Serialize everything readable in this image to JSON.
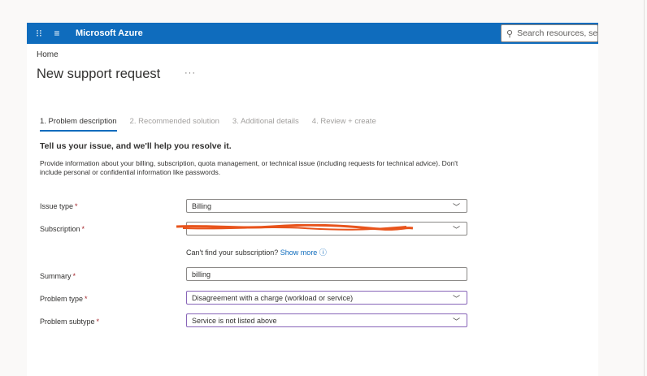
{
  "header": {
    "app_name": "Microsoft Azure",
    "search_placeholder": "Search resources, ser"
  },
  "breadcrumb": "Home",
  "page": {
    "title": "New support request",
    "more": "···"
  },
  "tabs": [
    {
      "label": "1. Problem description",
      "active": true
    },
    {
      "label": "2. Recommended solution",
      "active": false
    },
    {
      "label": "3. Additional details",
      "active": false
    },
    {
      "label": "4. Review + create",
      "active": false
    }
  ],
  "form": {
    "heading": "Tell us your issue, and we'll help you resolve it.",
    "description": "Provide information about your billing, subscription, quota management, or technical issue (including requests for technical advice). Don't include personal or confidential information like passwords.",
    "issue_type": {
      "label": "Issue type",
      "value": "Billing"
    },
    "subscription": {
      "label": "Subscription",
      "value": ""
    },
    "subscription_hint": "Can't find your subscription?",
    "show_more": "Show more",
    "summary": {
      "label": "Summary",
      "value": "billing"
    },
    "problem_type": {
      "label": "Problem type",
      "value": "Disagreement with a charge (workload or service)"
    },
    "problem_subtype": {
      "label": "Problem subtype",
      "value": "Service is not listed above"
    },
    "required_mark": "*"
  },
  "colors": {
    "azure_blue": "#0f6cbd",
    "required_red": "#a4262c",
    "redaction": "#e8541c",
    "focus_purple": "#8764b8"
  },
  "icons": {
    "waffle": "waffle-icon",
    "menu": "hamburger-icon",
    "search": "search-icon",
    "chevron": "chevron-down-icon",
    "info": "info-icon"
  }
}
